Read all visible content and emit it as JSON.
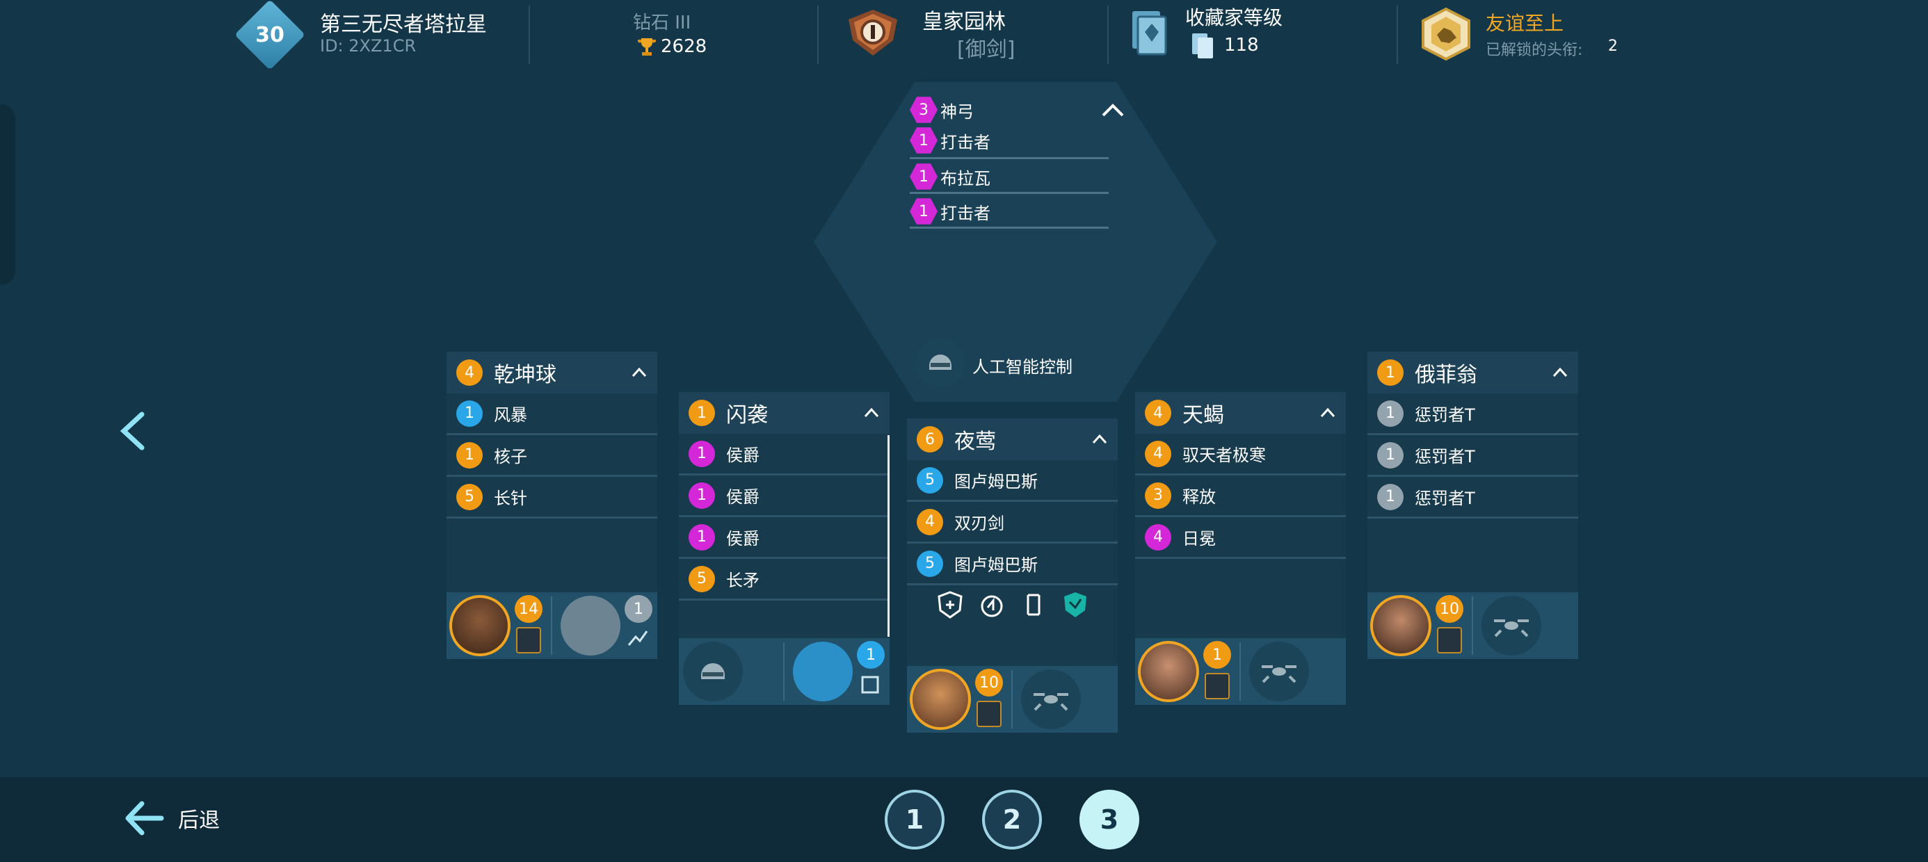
{
  "header": {
    "player_level": "30",
    "player_name": "第三无尽者塔拉星",
    "player_id": "ID: 2XZ1CR",
    "league_name": "钻石 III",
    "trophies": "2628",
    "clan_name": "皇家园林",
    "clan_tag": "[御剑]",
    "collector_label": "收藏家等级",
    "collector_value": "118",
    "title_name": "友谊至上",
    "titles_label": "已解锁的头衔:",
    "titles_count": "2"
  },
  "colors": {
    "background": "#133749",
    "accent_gold": "#f0a623",
    "level_orange": "#f19a13",
    "level_blue": "#2aa7e8",
    "level_magenta": "#d428d8",
    "level_gray": "#93a4ae"
  },
  "top_hex": {
    "rows": [
      {
        "level": "3",
        "name": "神弓"
      },
      {
        "level": "1",
        "name": "打击者"
      },
      {
        "level": "1",
        "name": "布拉瓦"
      },
      {
        "level": "1",
        "name": "打击者"
      }
    ],
    "pilot_label": "人工智能控制"
  },
  "cards": [
    {
      "level": "4",
      "title": "乾坤球",
      "rows": [
        {
          "level": "1",
          "color": "blue",
          "name": "风暴"
        },
        {
          "level": "1",
          "color": "orange",
          "name": "核子"
        },
        {
          "level": "5",
          "color": "orange",
          "name": "长针"
        }
      ],
      "pilot_level": "14",
      "drone_level": "1"
    },
    {
      "level": "1",
      "title": "闪袭",
      "rows": [
        {
          "level": "1",
          "color": "magenta",
          "name": "侯爵"
        },
        {
          "level": "1",
          "color": "magenta",
          "name": "侯爵"
        },
        {
          "level": "1",
          "color": "magenta",
          "name": "侯爵"
        },
        {
          "level": "5",
          "color": "orange",
          "name": "长矛"
        }
      ],
      "drone_level": "1"
    },
    {
      "level": "6",
      "title": "夜莺",
      "rows": [
        {
          "level": "5",
          "color": "blue",
          "name": "图卢姆巴斯"
        },
        {
          "level": "4",
          "color": "orange",
          "name": "双刃剑"
        },
        {
          "level": "5",
          "color": "blue",
          "name": "图卢姆巴斯"
        }
      ],
      "pilot_level": "10"
    },
    {
      "level": "4",
      "title": "天蝎",
      "rows": [
        {
          "level": "4",
          "color": "orange",
          "name": "驭天者极寒"
        },
        {
          "level": "3",
          "color": "orange",
          "name": "释放"
        },
        {
          "level": "4",
          "color": "magenta",
          "name": "日冕"
        }
      ],
      "pilot_level": "1"
    },
    {
      "level": "1",
      "title": "俄菲翁",
      "rows": [
        {
          "level": "1",
          "color": "gray",
          "name": "惩罚者T"
        },
        {
          "level": "1",
          "color": "gray",
          "name": "惩罚者T"
        },
        {
          "level": "1",
          "color": "gray",
          "name": "惩罚者T"
        }
      ],
      "pilot_level": "10"
    }
  ],
  "footer": {
    "back_label": "后退",
    "pages": [
      "1",
      "2",
      "3"
    ],
    "active_page": "3"
  }
}
